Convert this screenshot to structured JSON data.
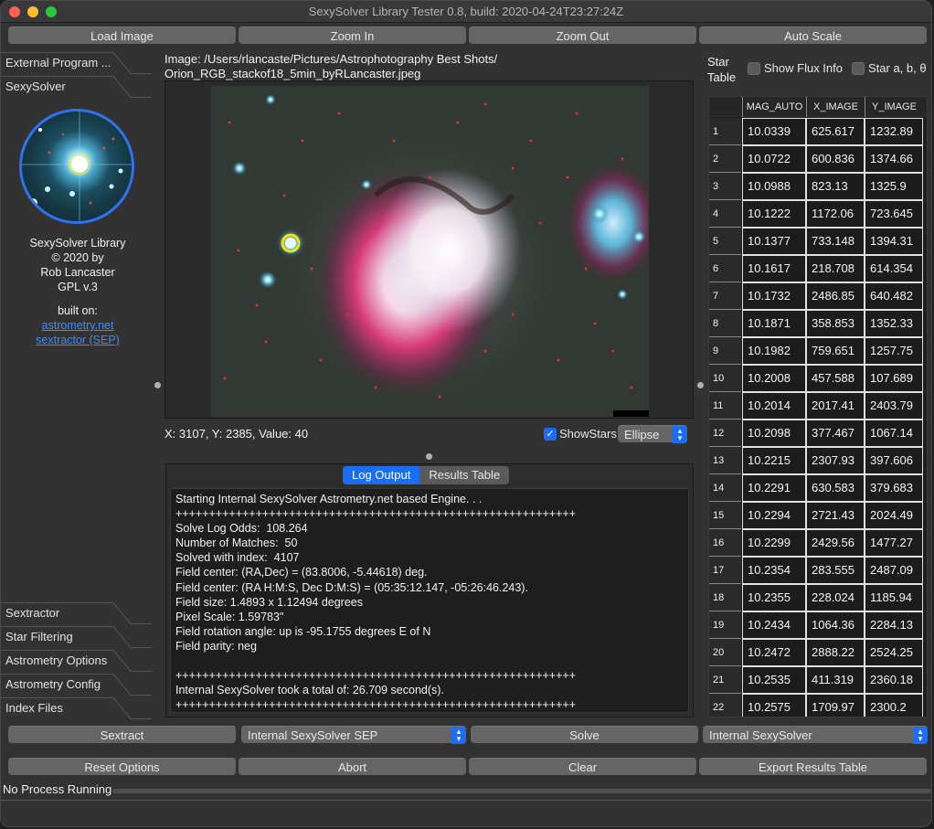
{
  "window": {
    "title": "SexySolver Library Tester 0.8, build: 2020-04-24T23:27:24Z"
  },
  "toolbar": {
    "load_image": "Load Image",
    "zoom_in": "Zoom In",
    "zoom_out": "Zoom Out",
    "auto_scale": "Auto Scale"
  },
  "left_tabs": {
    "top": [
      {
        "label": "External Program ..."
      },
      {
        "label": "SexySolver"
      }
    ],
    "bottom": [
      {
        "label": "Sextractor"
      },
      {
        "label": "Star Filtering"
      },
      {
        "label": "Astrometry Options"
      },
      {
        "label": "Astrometry Config"
      },
      {
        "label": "Index Files"
      }
    ]
  },
  "about": {
    "line1": "SexySolver Library",
    "line2": "© 2020 by",
    "line3": "Rob Lancaster",
    "line4": "GPL v.3",
    "built_on": "built on:",
    "link1": "astrometry.net",
    "link2": "sextractor (SEP)",
    "link_color": "#3d8bff"
  },
  "image": {
    "path_line1": "Image: /Users/rlancaste/Pictures/Astrophotography Best Shots/",
    "path_line2": "Orion_RGB_stackof18_5min_byRLancaster.jpeg",
    "coords_readout": "X: 3107, Y: 2385, Value: 40",
    "show_stars_label": "ShowStars",
    "show_stars_checked": true,
    "star_shape_selected": "Ellipse"
  },
  "log": {
    "tabs": [
      {
        "label": "Log Output",
        "active": true
      },
      {
        "label": "Results Table",
        "active": false
      }
    ],
    "lines": [
      "Starting Internal SexySolver Astrometry.net based Engine. . .",
      "++++++++++++++++++++++++++++++++++++++++++++++++++++++++++++",
      "Solve Log Odds:  108.264",
      "Number of Matches:  50",
      "Solved with index:  4107",
      "Field center: (RA,Dec) = (83.8006, -5.44618) deg.",
      "Field center: (RA H:M:S, Dec D:M:S) = (05:35:12.147, -05:26:46.243).",
      "Field size: 1.4893 x 1.12494 degrees",
      "Pixel Scale: 1.59783\"",
      "Field rotation angle: up is -95.1755 degrees E of N",
      "Field parity: neg",
      "",
      "++++++++++++++++++++++++++++++++++++++++++++++++++++++++++++",
      "Internal SexySolver took a total of: 26.709 second(s).",
      "++++++++++++++++++++++++++++++++++++++++++++++++++++++++++++"
    ]
  },
  "star_table": {
    "title_line1": "Star",
    "title_line2": "Table",
    "show_flux_label": "Show Flux Info",
    "show_flux_checked": false,
    "star_abt_label": "Star a, b, θ",
    "star_abt_checked": false,
    "columns": [
      "MAG_AUTO",
      "X_IMAGE",
      "Y_IMAGE"
    ],
    "rows": [
      [
        "1",
        "10.0339",
        "625.617",
        "1232.89"
      ],
      [
        "2",
        "10.0722",
        "600.836",
        "1374.66"
      ],
      [
        "3",
        "10.0988",
        "823.13",
        "1325.9"
      ],
      [
        "4",
        "10.1222",
        "1172.06",
        "723.645"
      ],
      [
        "5",
        "10.1377",
        "733.148",
        "1394.31"
      ],
      [
        "6",
        "10.1617",
        "218.708",
        "614.354"
      ],
      [
        "7",
        "10.1732",
        "2486.85",
        "640.482"
      ],
      [
        "8",
        "10.1871",
        "358.853",
        "1352.33"
      ],
      [
        "9",
        "10.1982",
        "759.651",
        "1257.75"
      ],
      [
        "10",
        "10.2008",
        "457.588",
        "107.689"
      ],
      [
        "11",
        "10.2014",
        "2017.41",
        "2403.79"
      ],
      [
        "12",
        "10.2098",
        "377.467",
        "1067.14"
      ],
      [
        "13",
        "10.2215",
        "2307.93",
        "397.606"
      ],
      [
        "14",
        "10.2291",
        "630.583",
        "379.683"
      ],
      [
        "15",
        "10.2294",
        "2721.43",
        "2024.49"
      ],
      [
        "16",
        "10.2299",
        "2429.56",
        "1477.27"
      ],
      [
        "17",
        "10.2354",
        "283.555",
        "2487.09"
      ],
      [
        "18",
        "10.2355",
        "228.024",
        "1185.94"
      ],
      [
        "19",
        "10.2434",
        "1064.36",
        "2284.13"
      ],
      [
        "20",
        "10.2472",
        "2888.22",
        "2524.25"
      ],
      [
        "21",
        "10.2535",
        "411.319",
        "2360.18"
      ],
      [
        "22",
        "10.2575",
        "1709.97",
        "2300.2"
      ]
    ]
  },
  "actions": {
    "sextract": "Sextract",
    "sextractor_selected": "Internal SexySolver SEP",
    "solve": "Solve",
    "solver_selected": "Internal SexySolver",
    "reset_options": "Reset Options",
    "abort": "Abort",
    "clear": "Clear",
    "export_results": "Export Results Table"
  },
  "status": {
    "text": "No Process Running",
    "progress": 0
  },
  "colors": {
    "accent": "#1b6ef3",
    "window_bg": "#323232",
    "button_bg": "#656565"
  }
}
